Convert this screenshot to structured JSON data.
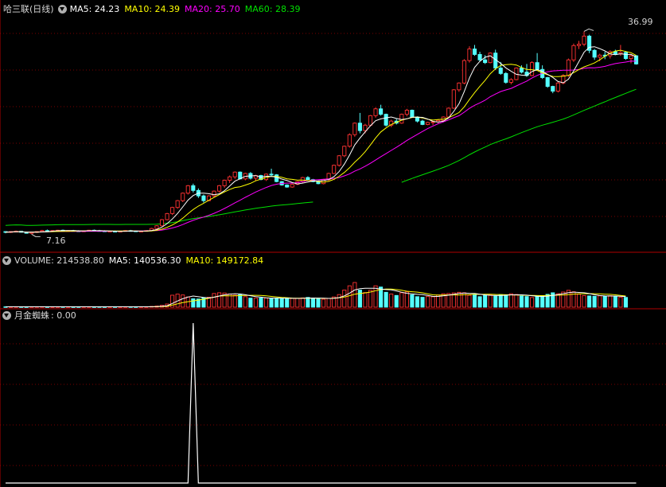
{
  "colors": {
    "up": "#ff3232",
    "down": "#54ffff",
    "ma5": "#ffffff",
    "ma10": "#ffff00",
    "ma20": "#ff00ff",
    "ma60": "#00e000",
    "grid": "#7a0000",
    "text": "#c8c8c8",
    "indicator": "#ffffff"
  },
  "main_panel": {
    "title": "哈三联(日线)",
    "ma5_label": "MA5: 24.23",
    "ma10_label": "MA10: 24.39",
    "ma20_label": "MA20: 25.70",
    "ma60_label": "MA60: 28.39",
    "high_label": "36.99",
    "low_label": "7.16"
  },
  "volume_panel": {
    "volume_label": "VOLUME: 214538.80",
    "ma5_label": "MA5: 140536.30",
    "ma10_label": "MA10: 149172.84"
  },
  "indicator_panel": {
    "name_label": "月金蜘蛛",
    "value_label": ": 0.00"
  },
  "chart_data": {
    "type": "candlestick",
    "y_range": [
      6.5,
      39.5
    ],
    "candles": [
      [
        7.55,
        7.6,
        7.3,
        7.45
      ],
      [
        7.45,
        7.6,
        7.35,
        7.55
      ],
      [
        7.55,
        7.7,
        7.45,
        7.6
      ],
      [
        7.6,
        7.65,
        7.4,
        7.45
      ],
      [
        7.45,
        7.55,
        7.25,
        7.3
      ],
      [
        7.3,
        7.5,
        7.16,
        7.45
      ],
      [
        7.45,
        7.6,
        7.35,
        7.55
      ],
      [
        7.55,
        7.8,
        7.45,
        7.7
      ],
      [
        7.7,
        7.85,
        7.6,
        7.65
      ],
      [
        7.65,
        7.75,
        7.55,
        7.7
      ],
      [
        7.7,
        7.8,
        7.6,
        7.75
      ],
      [
        7.75,
        7.85,
        7.6,
        7.65
      ],
      [
        7.65,
        7.75,
        7.55,
        7.7
      ],
      [
        7.7,
        7.8,
        7.6,
        7.65
      ],
      [
        7.65,
        7.75,
        7.55,
        7.6
      ],
      [
        7.6,
        7.7,
        7.5,
        7.65
      ],
      [
        7.65,
        7.8,
        7.6,
        7.75
      ],
      [
        7.75,
        7.85,
        7.65,
        7.7
      ],
      [
        7.7,
        7.8,
        7.6,
        7.65
      ],
      [
        7.65,
        7.75,
        7.5,
        7.55
      ],
      [
        7.55,
        7.65,
        7.45,
        7.6
      ],
      [
        7.6,
        7.7,
        7.5,
        7.55
      ],
      [
        7.55,
        7.65,
        7.45,
        7.6
      ],
      [
        7.6,
        7.75,
        7.55,
        7.7
      ],
      [
        7.7,
        7.8,
        7.6,
        7.65
      ],
      [
        7.65,
        7.7,
        7.5,
        7.55
      ],
      [
        7.55,
        7.65,
        7.45,
        7.6
      ],
      [
        7.6,
        7.75,
        7.55,
        7.7
      ],
      [
        7.7,
        8.1,
        7.6,
        8.0
      ],
      [
        8.0,
        8.5,
        7.9,
        8.4
      ],
      [
        8.4,
        9.4,
        8.3,
        9.3
      ],
      [
        9.3,
        10.3,
        9.2,
        10.2
      ],
      [
        10.2,
        11.2,
        10.0,
        11.1
      ],
      [
        11.1,
        12.2,
        10.9,
        12.1
      ],
      [
        12.1,
        13.3,
        11.9,
        13.2
      ],
      [
        13.2,
        14.4,
        13.0,
        14.3
      ],
      [
        14.3,
        14.6,
        13.3,
        13.6
      ],
      [
        13.6,
        13.9,
        12.5,
        12.8
      ],
      [
        12.8,
        13.0,
        11.8,
        12.1
      ],
      [
        12.1,
        12.9,
        12.0,
        12.8
      ],
      [
        12.8,
        13.6,
        12.6,
        13.5
      ],
      [
        13.5,
        14.4,
        13.3,
        14.3
      ],
      [
        14.3,
        15.2,
        14.0,
        15.1
      ],
      [
        15.1,
        15.8,
        14.7,
        15.6
      ],
      [
        15.6,
        16.4,
        15.3,
        16.3
      ],
      [
        16.3,
        16.4,
        15.2,
        15.3
      ],
      [
        15.3,
        16.2,
        15.1,
        16.1
      ],
      [
        16.1,
        16.3,
        15.2,
        15.4
      ],
      [
        15.4,
        15.9,
        15.0,
        15.8
      ],
      [
        15.8,
        15.9,
        15.1,
        15.2
      ],
      [
        15.2,
        16.1,
        15.0,
        16.0
      ],
      [
        16.0,
        16.8,
        15.7,
        15.9
      ],
      [
        15.9,
        16.0,
        14.8,
        14.9
      ],
      [
        14.9,
        15.0,
        14.3,
        14.4
      ],
      [
        14.4,
        14.5,
        14.0,
        14.1
      ],
      [
        14.1,
        14.6,
        14.0,
        14.5
      ],
      [
        14.5,
        15.0,
        14.4,
        14.9
      ],
      [
        14.9,
        15.6,
        14.7,
        15.5
      ],
      [
        15.5,
        15.7,
        15.1,
        15.2
      ],
      [
        15.2,
        15.3,
        14.8,
        14.9
      ],
      [
        14.9,
        15.0,
        14.5,
        14.6
      ],
      [
        14.6,
        15.3,
        14.5,
        15.2
      ],
      [
        15.2,
        16.2,
        15.0,
        16.1
      ],
      [
        16.1,
        17.4,
        16.0,
        17.3
      ],
      [
        17.3,
        18.8,
        17.1,
        18.7
      ],
      [
        18.7,
        20.2,
        18.5,
        20.1
      ],
      [
        20.1,
        22.0,
        19.9,
        21.8
      ],
      [
        21.8,
        23.6,
        21.5,
        23.5
      ],
      [
        23.5,
        25.0,
        22.0,
        22.4
      ],
      [
        22.4,
        23.4,
        22.0,
        23.2
      ],
      [
        23.2,
        24.7,
        23.0,
        24.6
      ],
      [
        24.6,
        25.8,
        24.3,
        25.6
      ],
      [
        25.6,
        26.2,
        24.6,
        24.8
      ],
      [
        24.8,
        24.9,
        23.0,
        23.2
      ],
      [
        23.2,
        24.0,
        22.9,
        23.8
      ],
      [
        23.8,
        24.1,
        23.3,
        23.5
      ],
      [
        23.5,
        24.9,
        23.4,
        24.8
      ],
      [
        24.8,
        25.6,
        24.5,
        25.4
      ],
      [
        25.4,
        25.5,
        24.3,
        24.4
      ],
      [
        24.4,
        24.5,
        23.6,
        23.8
      ],
      [
        23.8,
        24.0,
        23.2,
        23.3
      ],
      [
        23.3,
        23.7,
        23.2,
        23.6
      ],
      [
        23.6,
        23.8,
        23.2,
        23.7
      ],
      [
        23.7,
        24.1,
        23.5,
        23.9
      ],
      [
        23.9,
        24.5,
        23.8,
        24.4
      ],
      [
        24.4,
        25.8,
        24.3,
        25.7
      ],
      [
        25.7,
        28.5,
        25.6,
        28.4
      ],
      [
        28.4,
        29.5,
        28.1,
        29.4
      ],
      [
        29.4,
        32.9,
        29.2,
        32.7
      ],
      [
        32.7,
        34.8,
        32.4,
        34.4
      ],
      [
        34.4,
        35.0,
        33.4,
        33.6
      ],
      [
        33.6,
        34.0,
        32.6,
        32.8
      ],
      [
        32.8,
        33.5,
        32.2,
        32.4
      ],
      [
        32.4,
        33.9,
        32.3,
        33.8
      ],
      [
        33.8,
        34.3,
        31.3,
        31.6
      ],
      [
        31.6,
        32.5,
        30.6,
        30.8
      ],
      [
        30.8,
        31.0,
        29.3,
        29.5
      ],
      [
        29.5,
        30.1,
        29.2,
        29.9
      ],
      [
        29.9,
        31.7,
        29.8,
        31.6
      ],
      [
        31.6,
        32.0,
        30.8,
        31.0
      ],
      [
        31.0,
        32.2,
        30.3,
        30.5
      ],
      [
        30.5,
        32.6,
        30.4,
        32.4
      ],
      [
        32.4,
        33.8,
        32.0,
        31.4
      ],
      [
        31.4,
        32.0,
        30.0,
        30.2
      ],
      [
        30.2,
        30.3,
        28.7,
        28.9
      ],
      [
        28.9,
        29.0,
        27.9,
        28.2
      ],
      [
        28.2,
        29.6,
        28.0,
        29.4
      ],
      [
        29.4,
        30.7,
        29.2,
        30.5
      ],
      [
        30.5,
        33.0,
        30.3,
        32.8
      ],
      [
        32.8,
        35.2,
        32.5,
        34.9
      ],
      [
        34.9,
        35.6,
        34.4,
        35.1
      ],
      [
        35.1,
        36.99,
        34.8,
        36.3
      ],
      [
        36.3,
        36.5,
        33.8,
        34.2
      ],
      [
        34.2,
        34.4,
        32.8,
        33.2
      ],
      [
        33.2,
        33.7,
        32.6,
        33.5
      ],
      [
        33.5,
        34.0,
        32.9,
        33.4
      ],
      [
        33.4,
        34.2,
        33.0,
        34.0
      ],
      [
        34.0,
        34.3,
        33.5,
        33.7
      ],
      [
        33.7,
        35.0,
        33.4,
        33.9
      ],
      [
        33.9,
        34.1,
        32.8,
        33.0
      ],
      [
        33.0,
        33.7,
        32.3,
        33.4
      ],
      [
        33.4,
        33.5,
        32.1,
        32.2
      ]
    ],
    "volume_range": [
      0,
      300000
    ],
    "volumes": [
      3200,
      3000,
      3500,
      3100,
      2800,
      3300,
      3600,
      4000,
      3100,
      2900,
      3200,
      3300,
      3000,
      2800,
      3100,
      3400,
      3200,
      3000,
      3300,
      2900,
      3100,
      3200,
      2800,
      3300,
      3500,
      3100,
      3000,
      3200,
      6000,
      9000,
      15000,
      26000,
      98000,
      107000,
      100000,
      84000,
      69000,
      67000,
      78000,
      81000,
      112000,
      118000,
      116000,
      108000,
      98000,
      102000,
      86000,
      74000,
      74000,
      75000,
      75000,
      74000,
      74000,
      70000,
      71000,
      72000,
      72000,
      76000,
      80000,
      75000,
      68000,
      65000,
      71000,
      84000,
      103000,
      140000,
      175000,
      202000,
      140000,
      120000,
      138000,
      175000,
      165000,
      122000,
      108000,
      96000,
      118000,
      125000,
      101000,
      86000,
      81000,
      87000,
      85000,
      100000,
      110000,
      112000,
      117000,
      122000,
      118000,
      98000,
      105000,
      86000,
      95000,
      101000,
      91000,
      103000,
      99000,
      110000,
      104000,
      91000,
      87000,
      79000,
      86000,
      95000,
      105000,
      118000,
      110000,
      124000,
      138000,
      126000,
      106000,
      95000,
      92000,
      89000,
      93000,
      90000,
      94000,
      89000,
      82000,
      80000
    ],
    "indicator_range": [
      0,
      200
    ],
    "indicator_values": [
      0,
      0,
      0,
      0,
      0,
      0,
      0,
      0,
      0,
      0,
      0,
      0,
      0,
      0,
      0,
      0,
      0,
      0,
      0,
      0,
      0,
      0,
      0,
      0,
      0,
      0,
      0,
      0,
      0,
      0,
      0,
      0,
      0,
      0,
      0,
      0,
      0,
      0,
      0,
      0,
      0,
      0,
      0,
      0,
      0,
      0,
      0,
      0,
      0,
      0,
      0,
      0,
      0,
      0,
      0,
      0,
      0,
      0,
      0,
      0,
      0,
      0,
      0,
      0,
      0,
      0,
      0,
      0,
      0,
      0,
      0,
      0,
      0,
      0,
      0,
      0,
      0,
      0,
      0,
      0,
      0,
      0,
      0,
      0,
      0,
      0,
      0,
      0,
      0,
      0,
      0,
      0,
      0,
      0,
      0,
      0,
      0,
      0,
      0,
      0,
      0,
      0,
      0,
      0,
      0,
      0,
      0,
      0,
      0,
      0,
      0,
      0,
      0,
      0,
      0,
      0,
      0,
      0,
      0,
      0,
      0,
      0
    ],
    "indicator_spikes": [
      {
        "index": 36,
        "value": 200
      }
    ]
  }
}
